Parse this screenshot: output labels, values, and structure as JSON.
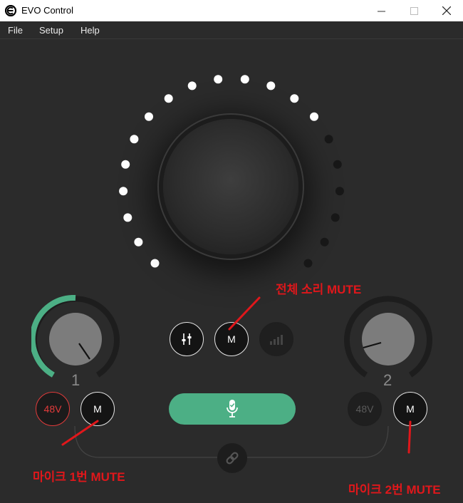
{
  "window": {
    "title": "EVO Control",
    "minimize": "—",
    "maximize": "☐",
    "close": "✕"
  },
  "menu": {
    "items": [
      "File",
      "Setup",
      "Help"
    ]
  },
  "channels": {
    "ch1": {
      "number": "1",
      "phantom_label": "48V",
      "mute_label": "M",
      "gain_fraction": 0.35
    },
    "ch2": {
      "number": "2",
      "phantom_label": "48V",
      "mute_label": "M"
    }
  },
  "center": {
    "mute_label": "M",
    "mixer_icon": "mixer-sliders-icon",
    "meter_icon": "signal-bars-icon",
    "mic_icon": "microphone-icon",
    "link_icon": "link-icon"
  },
  "annotations": {
    "master_mute": "전체 소리 MUTE",
    "mic1_mute": "마이크 1번 MUTE",
    "mic2_mute": "마이크 2번 MUTE"
  },
  "colors": {
    "accent_green": "#4caf85",
    "phantom_red": "#e23b3b",
    "annotation_red": "#e0171b"
  }
}
